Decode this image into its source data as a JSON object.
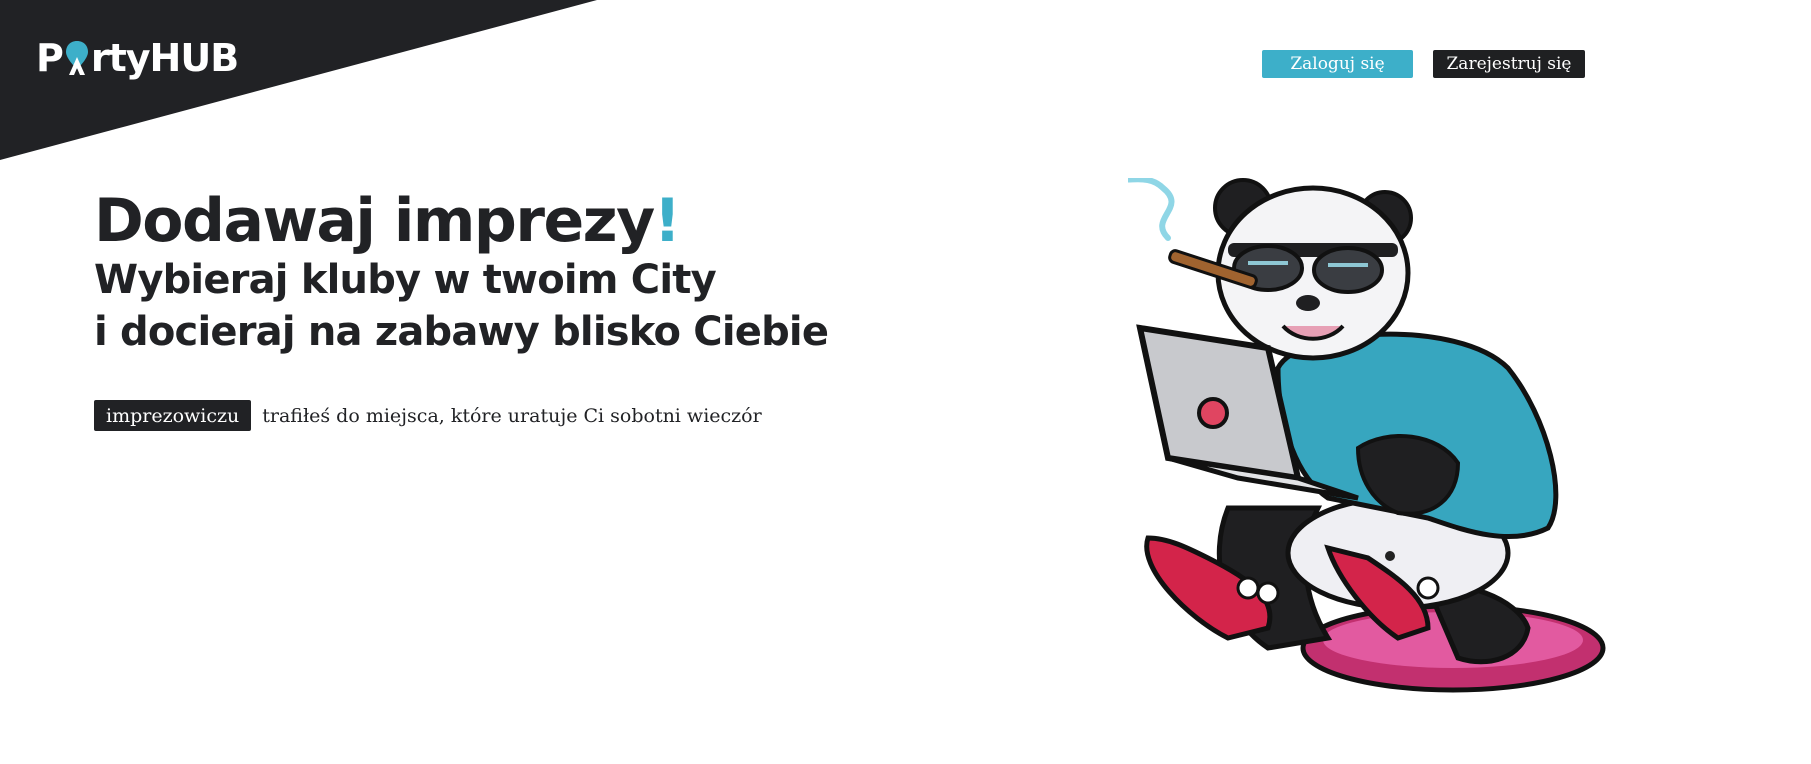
{
  "brand": {
    "logo_text_left": "P",
    "logo_text_right": "rtyHUB",
    "colors": {
      "dark": "#212225",
      "accent": "#3dafc9",
      "white": "#ffffff"
    }
  },
  "header": {
    "login_label": "Zaloguj się",
    "register_label": "Zarejestruj się"
  },
  "hero": {
    "headline": "Dodawaj imprezy",
    "headline_mark": "!",
    "line2": "Wybieraj kluby w twoim City",
    "line3": "i docieraj na zabawy blisko Ciebie"
  },
  "tagline": {
    "badge": "imprezowiczu",
    "text": "trafiłeś do miejsca, które uratuje Ci sobotni wieczór"
  },
  "illustration": {
    "icon": "panda-with-laptop-illustration"
  }
}
